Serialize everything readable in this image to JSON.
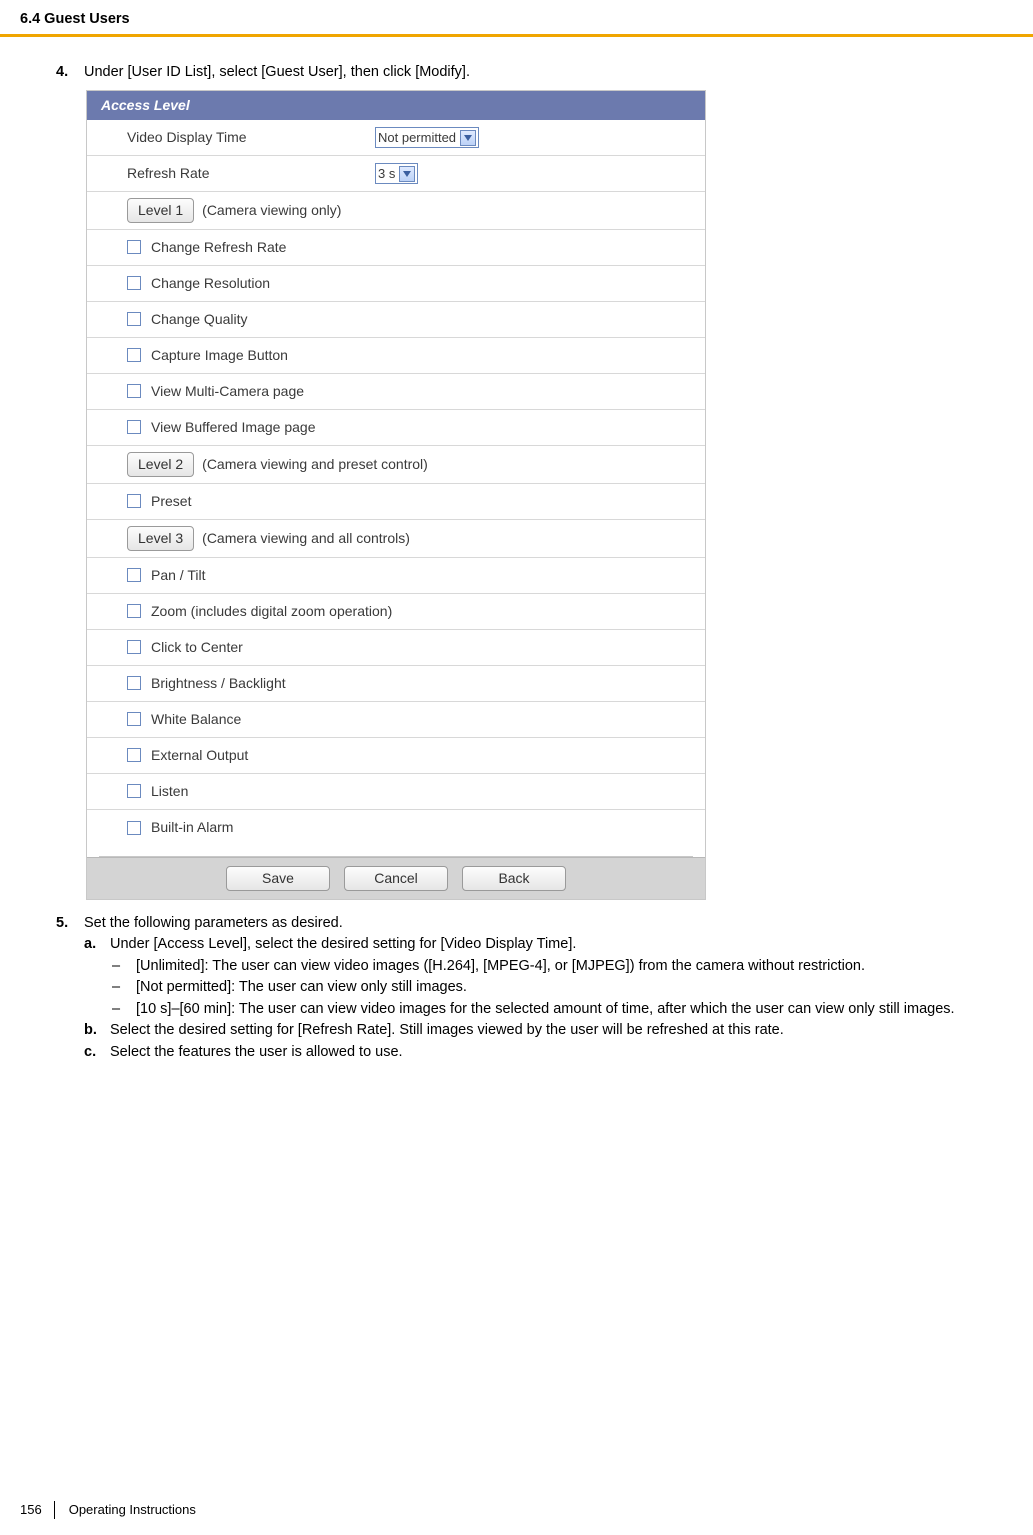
{
  "header": {
    "section": "6.4 Guest Users"
  },
  "step4": {
    "num": "4.",
    "text": "Under [User ID List], select [Guest User], then click [Modify]."
  },
  "panel": {
    "title": "Access Level",
    "video_label": "Video Display Time",
    "video_value": "Not permitted",
    "refresh_label": "Refresh Rate",
    "refresh_value": "3 s",
    "level1_btn": "Level 1",
    "level1_desc": "(Camera viewing only)",
    "cb_change_refresh": "Change Refresh Rate",
    "cb_change_resolution": "Change Resolution",
    "cb_change_quality": "Change Quality",
    "cb_capture": "Capture Image Button",
    "cb_multi": "View Multi-Camera page",
    "cb_buffered": "View Buffered Image page",
    "level2_btn": "Level 2",
    "level2_desc": "(Camera viewing and preset control)",
    "cb_preset": "Preset",
    "level3_btn": "Level 3",
    "level3_desc": "(Camera viewing and all controls)",
    "cb_pantilt": "Pan / Tilt",
    "cb_zoom": "Zoom (includes digital zoom operation)",
    "cb_click_center": "Click to Center",
    "cb_brightness": "Brightness / Backlight",
    "cb_white_balance": "White Balance",
    "cb_external": "External Output",
    "cb_listen": "Listen",
    "cb_alarm": "Built-in Alarm",
    "save_btn": "Save",
    "cancel_btn": "Cancel",
    "back_btn": "Back"
  },
  "step5": {
    "num": "5.",
    "text": "Set the following parameters as desired.",
    "a_num": "a.",
    "a_text": "Under [Access Level], select the desired setting for [Video Display Time].",
    "a_d1": "[Unlimited]: The user can view video images ([H.264], [MPEG-4], or [MJPEG]) from the camera without restriction.",
    "a_d2": "[Not permitted]: The user can view only still images.",
    "a_d3": "[10 s]–[60 min]: The user can view video images for the selected amount of time, after which the user can view only still images.",
    "b_num": "b.",
    "b_text": "Select the desired setting for [Refresh Rate]. Still images viewed by the user will be refreshed at this rate.",
    "c_num": "c.",
    "c_text": "Select the features the user is allowed to use."
  },
  "footer": {
    "page_num": "156",
    "doc": "Operating Instructions"
  }
}
